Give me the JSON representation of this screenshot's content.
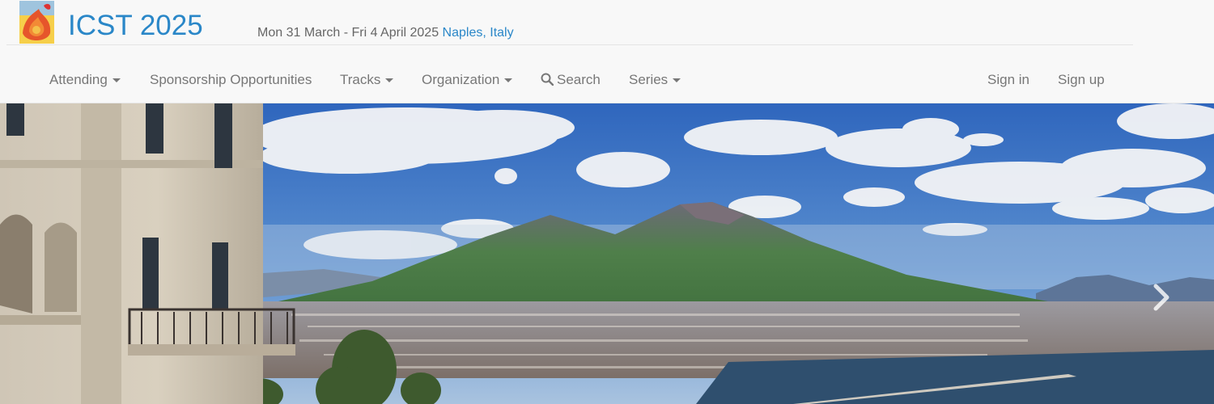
{
  "header": {
    "title": "ICST 2025",
    "dates": "Mon 31 March - Fri 4 April 2025",
    "location": "Naples, Italy"
  },
  "nav": {
    "attending": "Attending",
    "sponsorship": "Sponsorship Opportunities",
    "tracks": "Tracks",
    "organization": "Organization",
    "search": "Search",
    "series": "Series",
    "sign_in": "Sign in",
    "sign_up": "Sign up"
  },
  "icons": {
    "logo": "icst-logo",
    "search": "search-icon",
    "dropdown": "caret-down-icon",
    "carousel_next": "chevron-right-icon"
  },
  "colors": {
    "brand": "#2a87c8",
    "nav_text": "#777777",
    "sky": "#3d76c6"
  }
}
